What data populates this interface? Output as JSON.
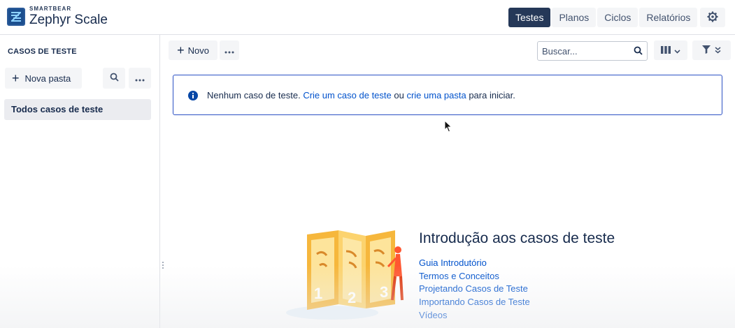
{
  "header": {
    "brand": "SMARTBEAR",
    "product": "Zephyr Scale",
    "nav": [
      {
        "label": "Testes",
        "active": true
      },
      {
        "label": "Planos",
        "active": false
      },
      {
        "label": "Ciclos",
        "active": false
      },
      {
        "label": "Relatórios",
        "active": false
      }
    ],
    "settings_icon": "gear-icon"
  },
  "sidebar": {
    "title": "CASOS DE TESTE",
    "new_folder_label": "Nova pasta",
    "search_icon": "search-icon",
    "more_icon": "more-icon",
    "root_folder_label": "Todos casos de teste"
  },
  "toolbar": {
    "new_label": "Novo",
    "search_placeholder": "Buscar...",
    "columns_icon": "columns-icon",
    "filter_icon": "filter-icon"
  },
  "info": {
    "text_before": "Nenhum caso de teste. ",
    "link_create_case": "Crie um caso de teste",
    "text_middle": " ou ",
    "link_create_folder": "crie uma pasta",
    "text_after": " para iniciar."
  },
  "intro": {
    "title": "Introdução aos casos de teste",
    "links": [
      "Guia Introdutório",
      "Termos e Conceitos",
      "Projetando Casos de Teste",
      "Importando Casos de Teste",
      "Vídeos"
    ],
    "illustration_numbers": [
      "1",
      "2",
      "3"
    ]
  },
  "colors": {
    "accent": "#2b50c4",
    "active_nav": "#253858",
    "link": "#0052cc",
    "illustration": "#f6b73c"
  }
}
